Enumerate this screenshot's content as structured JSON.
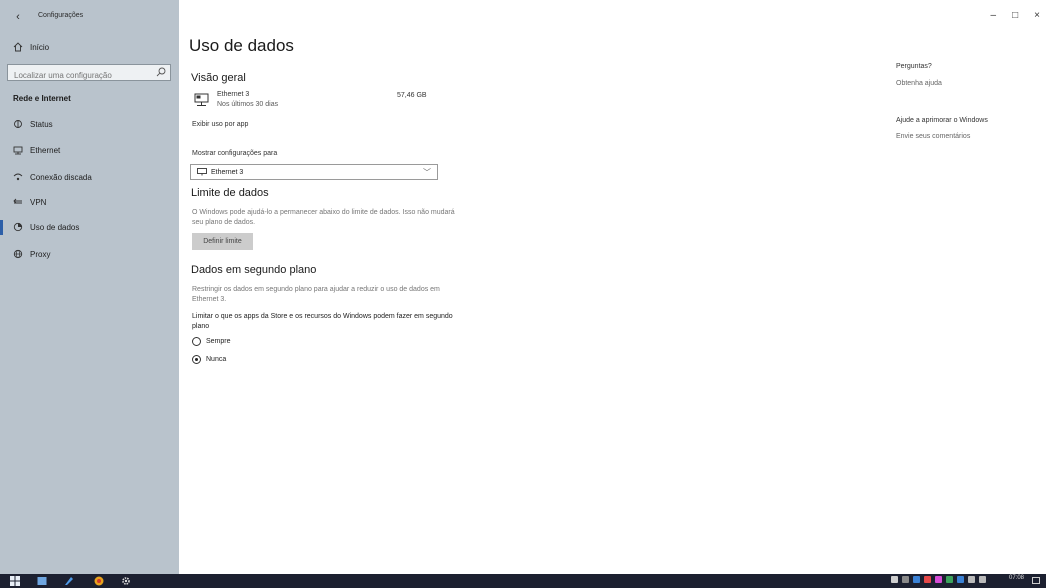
{
  "window": {
    "app_title": "Configurações",
    "minimize": "–",
    "maximize": "□",
    "close": "×"
  },
  "sidebar": {
    "home_label": "Início",
    "search_placeholder": "Localizar uma configuração",
    "section_label": "Rede e Internet",
    "items": [
      {
        "label": "Status",
        "icon": "status-icon"
      },
      {
        "label": "Ethernet",
        "icon": "ethernet-icon"
      },
      {
        "label": "Conexão discada",
        "icon": "dialup-icon"
      },
      {
        "label": "VPN",
        "icon": "vpn-icon"
      },
      {
        "label": "Uso de dados",
        "icon": "data-usage-icon",
        "selected": true
      },
      {
        "label": "Proxy",
        "icon": "proxy-icon"
      }
    ]
  },
  "main": {
    "title": "Uso de dados",
    "overview": {
      "heading": "Visão geral",
      "network_name": "Ethernet 3",
      "period": "Nos últimos 30 dias",
      "value": "57,46 GB",
      "usage_link": "Exibir uso por app"
    },
    "show_settings_label": "Mostrar configurações para",
    "selected_network": "Ethernet 3",
    "data_limit": {
      "heading": "Limite de dados",
      "description": "O Windows pode ajudá-lo a permanecer abaixo do limite de dados. Isso não mudará seu plano de dados.",
      "button": "Definir limite"
    },
    "background": {
      "heading": "Dados em segundo plano",
      "description": "Restringir os dados em segundo plano para ajudar a reduzir o uso de dados em Ethernet 3.",
      "limit_label": "Limitar o que os apps da Store e os recursos do Windows podem fazer em segundo plano",
      "options": [
        {
          "label": "Sempre",
          "selected": false
        },
        {
          "label": "Nunca",
          "selected": true
        }
      ]
    }
  },
  "right_panel": {
    "questions_heading": "Perguntas?",
    "get_help": "Obtenha ajuda",
    "improve_heading": "Ajude a aprimorar o Windows",
    "feedback": "Envie seus comentários"
  },
  "taskbar": {
    "time": "07:08"
  },
  "colors": {
    "sidebar_bg": "#b9c3cc",
    "accent": "#2d5fa8",
    "taskbar_bg": "#1c2030"
  }
}
